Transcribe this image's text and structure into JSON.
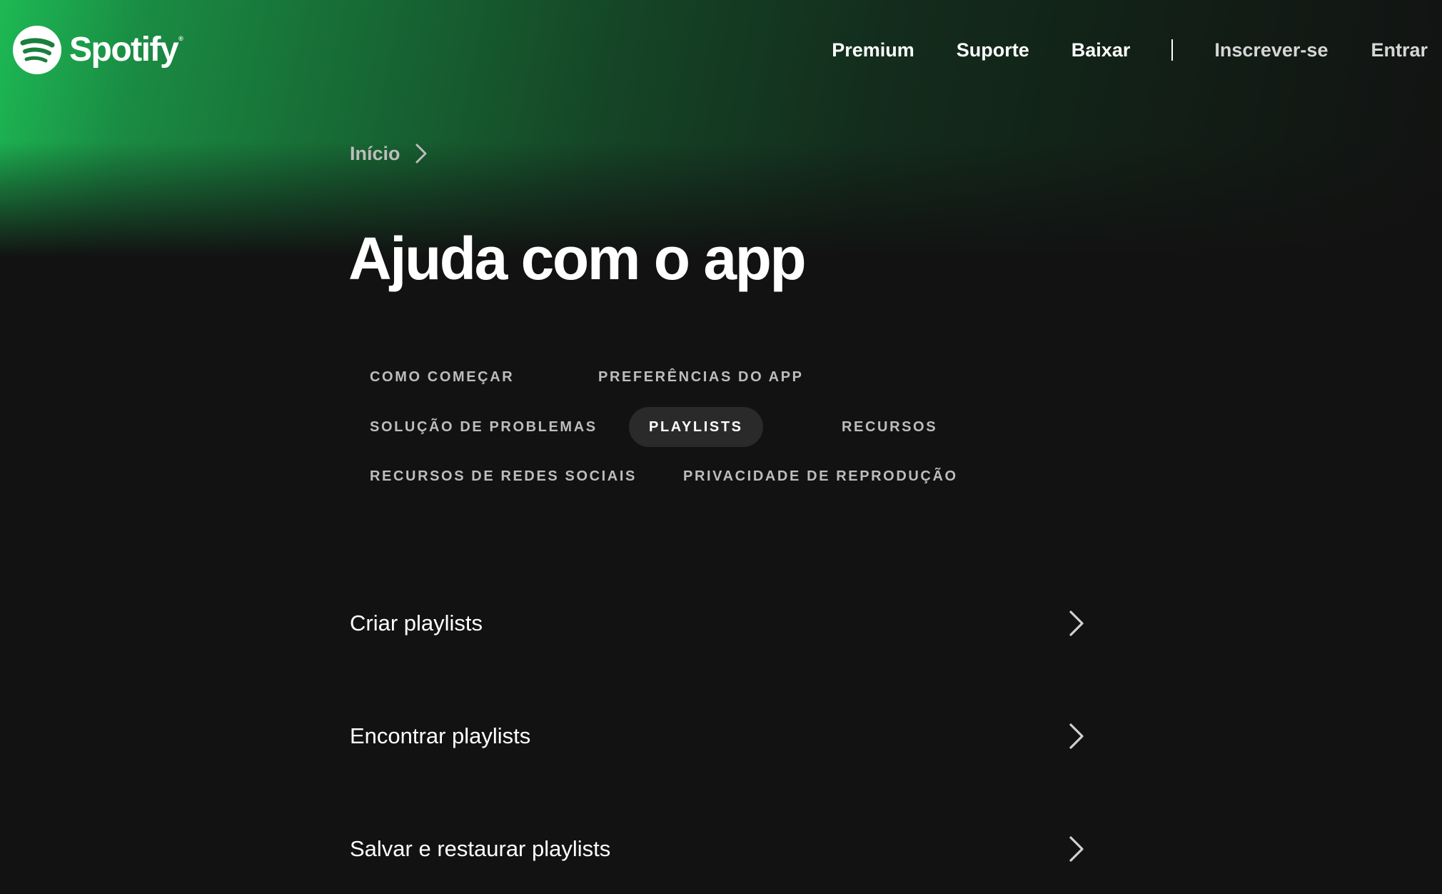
{
  "brand": {
    "name": "Spotify",
    "trademark": "®",
    "accent_color": "#1db954",
    "background_color": "#121212"
  },
  "topnav": {
    "items": [
      {
        "label": "Premium"
      },
      {
        "label": "Suporte"
      },
      {
        "label": "Baixar"
      },
      {
        "label": "Inscrever-se"
      },
      {
        "label": "Entrar"
      }
    ]
  },
  "breadcrumb": {
    "home_label": "Início",
    "separator_icon": "chevron-right-icon"
  },
  "page": {
    "title": "Ajuda com o app"
  },
  "categories": {
    "active_label": "PLAYLISTS",
    "items": [
      {
        "label": "COMO COMEÇAR"
      },
      {
        "label": "PREFERÊNCIAS DO APP"
      },
      {
        "label": "SOLUÇÃO DE PROBLEMAS"
      },
      {
        "label": "PLAYLISTS"
      },
      {
        "label": "RECURSOS"
      },
      {
        "label": "RECURSOS DE REDES SOCIAIS"
      },
      {
        "label": "PRIVACIDADE DE REPRODUÇÃO"
      }
    ]
  },
  "articles": {
    "row_icon": "chevron-right-icon",
    "items": [
      {
        "label": "Criar playlists"
      },
      {
        "label": "Encontrar playlists"
      },
      {
        "label": "Salvar e restaurar playlists"
      }
    ]
  }
}
